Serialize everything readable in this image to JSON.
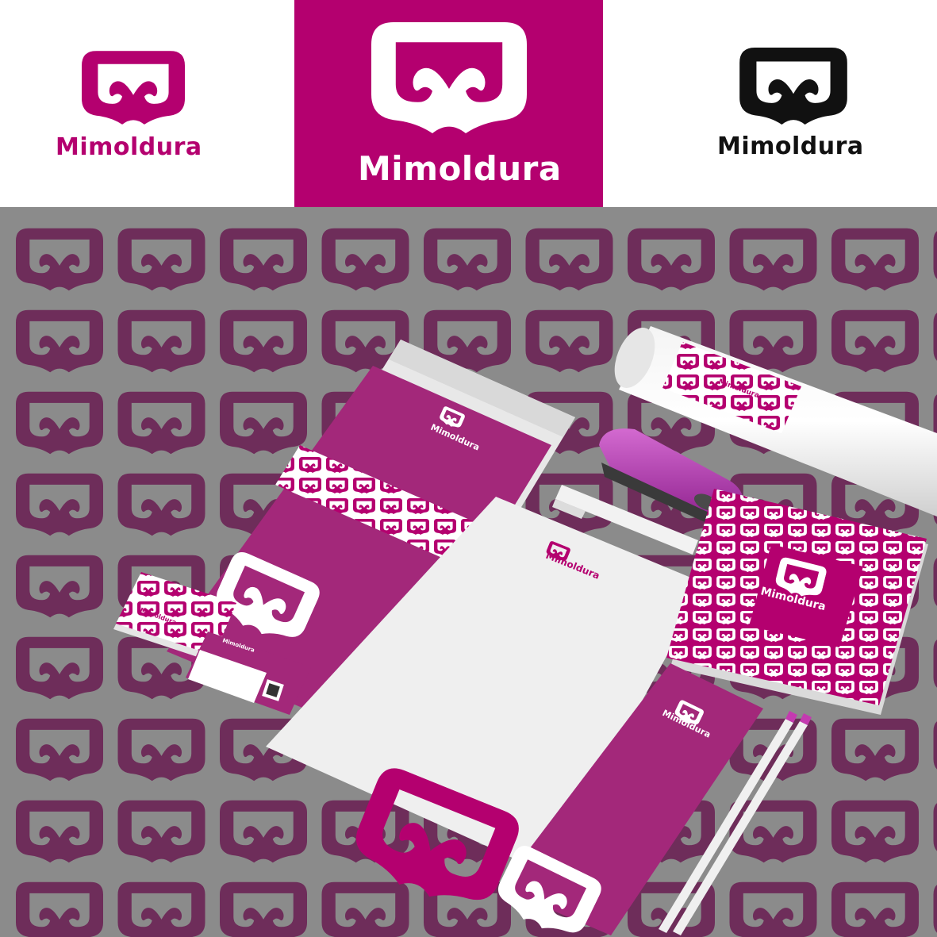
{
  "brand": {
    "name": "Mimoldura",
    "primary_color": "#b4006f",
    "secondary_color": "#9a2b77",
    "pattern_color": "#6e2d5a",
    "background_gray": "#8b8b8b",
    "black_color": "#111111"
  },
  "logo_strip": {
    "left": {
      "wordmark": "Mimoldura",
      "variant": "magenta-on-white"
    },
    "center": {
      "wordmark": "Mimoldura",
      "variant": "white-on-magenta"
    },
    "right": {
      "wordmark": "Mimoldura",
      "variant": "black-on-white"
    }
  },
  "mockup": {
    "envelope_label": "Mimoldura",
    "letterhead_label": "Mimoldura",
    "notebook_label": "Mimoldura",
    "card_label": "Mimoldura",
    "bookmark_label": "Mimoldura",
    "business_card_label": "Mimoldura",
    "icons": [
      "mimoldura-logo-icon",
      "qr-code-icon",
      "stapler-icon",
      "pencil-icon",
      "pen-icon",
      "poster-tube-icon"
    ]
  }
}
